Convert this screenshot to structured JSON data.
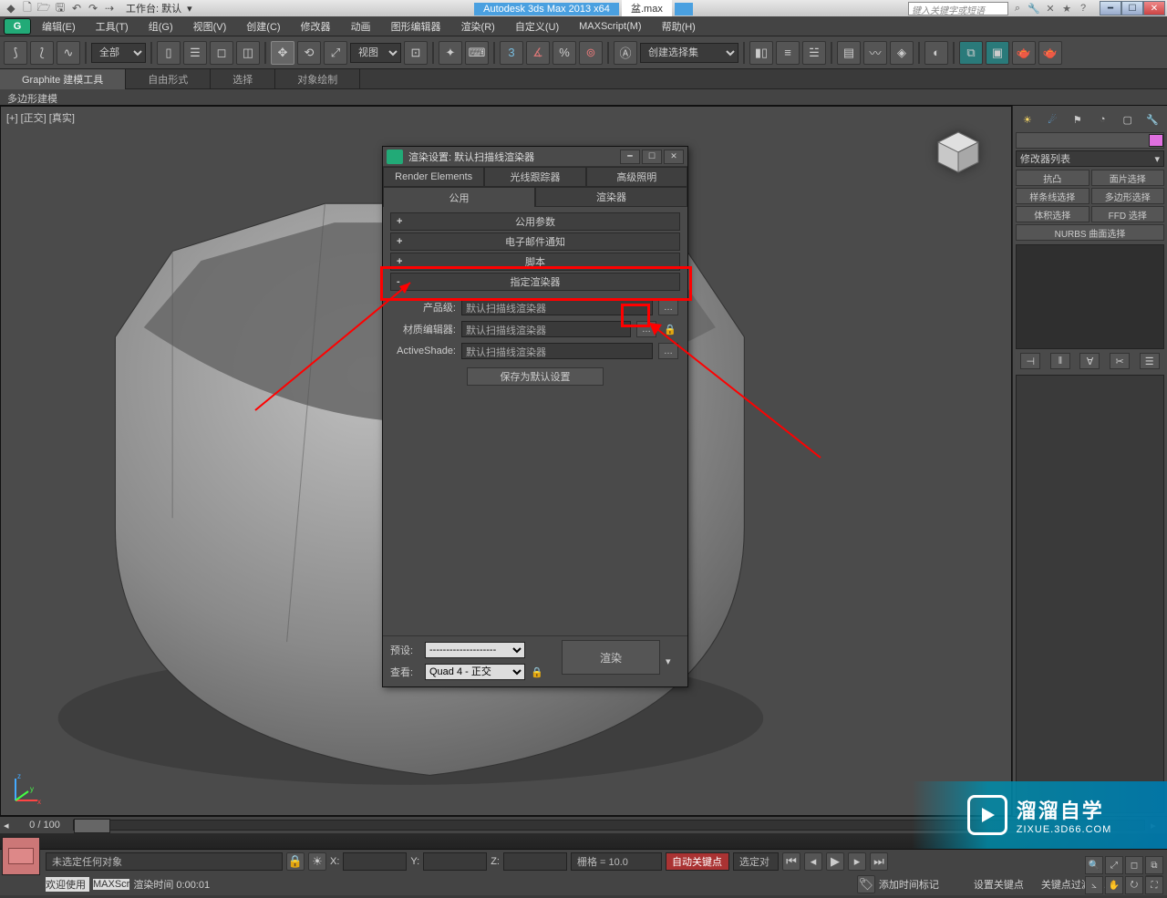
{
  "titlebar": {
    "workspace_label": "工作台: 默认",
    "app_title": "Autodesk 3ds Max  2013 x64",
    "file_name": "盆.max",
    "search_placeholder": "键入关键字或短语"
  },
  "menu": {
    "items": [
      "编辑(E)",
      "工具(T)",
      "组(G)",
      "视图(V)",
      "创建(C)",
      "修改器",
      "动画",
      "图形编辑器",
      "渲染(R)",
      "自定义(U)",
      "MAXScript(M)",
      "帮助(H)"
    ]
  },
  "toolbar": {
    "filter_label": "全部",
    "viewtype": "视图",
    "named_sel": "创建选择集"
  },
  "ribbon": {
    "tabs": [
      "Graphite 建模工具",
      "自由形式",
      "选择",
      "对象绘制"
    ],
    "subtab": "多边形建模"
  },
  "viewport": {
    "label": "[+] [正交] [真实]"
  },
  "sidepanel": {
    "modlist_label": "修改器列表",
    "buttons": [
      "抗凸",
      "面片选择",
      "样条线选择",
      "多边形选择",
      "体积选择",
      "FFD 选择",
      "NURBS 曲面选择"
    ]
  },
  "dialog": {
    "title": "渲染设置: 默认扫描线渲染器",
    "tabs_row1": [
      "Render Elements",
      "光线跟踪器",
      "高级照明"
    ],
    "tabs_row2": [
      "公用",
      "渲染器"
    ],
    "rollouts": {
      "r1": "公用参数",
      "r2": "电子邮件通知",
      "r3": "脚本",
      "r4": "指定渲染器"
    },
    "assign": {
      "row1_label": "产品级:",
      "row1_value": "默认扫描线渲染器",
      "row2_label": "材质编辑器:",
      "row2_value": "默认扫描线渲染器",
      "row3_label": "ActiveShade:",
      "row3_value": "默认扫描线渲染器",
      "save_button": "保存为默认设置"
    },
    "footer": {
      "preset_label": "预设:",
      "preset_value": "--------------------",
      "view_label": "查看:",
      "view_value": "Quad 4 - 正交",
      "render_button": "渲染"
    }
  },
  "status": {
    "frame": "0 / 100",
    "prompt": "未选定任何对象",
    "render_time_label": "渲染时间 0:00:01",
    "welcome": "欢迎使用",
    "maxscr": "MAXScr",
    "x": "X:",
    "y": "Y:",
    "z": "Z:",
    "grid": "栅格 = 10.0",
    "addtime": "添加时间标记",
    "autokey": "自动关键点",
    "selset": "选定对",
    "setkey": "设置关键点",
    "keyfilter": "关键点过滤器..."
  },
  "watermark": {
    "brand": "溜溜自学",
    "url": "ZIXUE.3D66.COM"
  }
}
